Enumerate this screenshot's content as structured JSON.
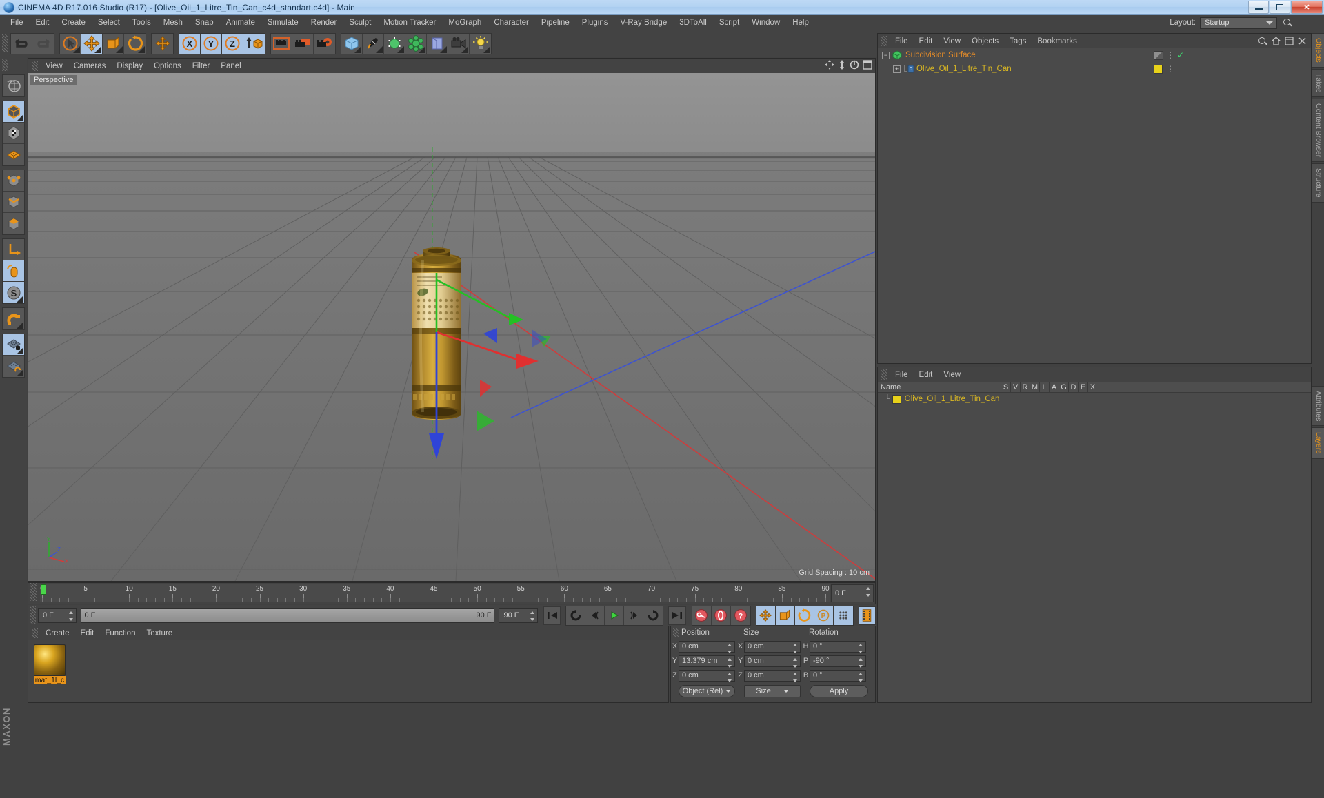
{
  "window": {
    "title": "CINEMA 4D R17.016 Studio (R17) - [Olive_Oil_1_Litre_Tin_Can_c4d_standart.c4d] - Main",
    "minimize": "–",
    "restore": "❐",
    "close": "X"
  },
  "menubar": {
    "items": [
      "File",
      "Edit",
      "Create",
      "Select",
      "Tools",
      "Mesh",
      "Snap",
      "Animate",
      "Simulate",
      "Render",
      "Sculpt",
      "Motion Tracker",
      "MoGraph",
      "Character",
      "Pipeline",
      "Plugins",
      "V-Ray Bridge",
      "3DToAll",
      "Script",
      "Window",
      "Help"
    ]
  },
  "layout": {
    "label": "Layout:",
    "value": "Startup",
    "search_icon": "search-icon"
  },
  "viewport": {
    "menu": [
      "View",
      "Cameras",
      "Display",
      "Options",
      "Filter",
      "Panel"
    ],
    "badge": "Perspective",
    "grid_spacing": "Grid Spacing : 10 cm",
    "axis_labels": {
      "x": "X",
      "y": "Y",
      "z": "Z"
    }
  },
  "timeline": {
    "ticks": [
      "0",
      "5",
      "10",
      "15",
      "20",
      "25",
      "30",
      "35",
      "40",
      "45",
      "50",
      "55",
      "60",
      "65",
      "70",
      "75",
      "80",
      "85",
      "90"
    ],
    "current_frame_field": "0 F",
    "range_start": "0 F",
    "range_end": "90 F",
    "max_frame_field": "90 F",
    "playhead_frame": 0
  },
  "animtools": {
    "frame_field": "0 F",
    "slider_left": "0 F",
    "slider_right": "90 F",
    "end_field": "90 F",
    "buttons": [
      "go-to-start-icon",
      "go-back-frame-icon",
      "play-back-icon",
      "play-icon",
      "play-forward-icon",
      "loop-icon",
      "go-to-end-icon",
      "record-key-icon",
      "autokey-icon",
      "key-help-icon",
      "position-key-icon",
      "scale-key-icon",
      "rotation-key-icon",
      "param-key-icon",
      "pla-key-icon",
      "timeline-strip-icon"
    ]
  },
  "material_manager": {
    "menu": [
      "Create",
      "Edit",
      "Function",
      "Texture"
    ],
    "materials": [
      {
        "name": "mat_1l_c",
        "thumb": "sphere-preview"
      }
    ]
  },
  "coordinates": {
    "headers": [
      "Position",
      "Size",
      "Rotation"
    ],
    "position": {
      "x": "0 cm",
      "y": "13.379 cm",
      "z": "0 cm"
    },
    "size": {
      "x": "0 cm",
      "y": "0 cm",
      "z": "0 cm"
    },
    "rotation": {
      "h": "0 °",
      "p": "-90 °",
      "b": "0 °"
    },
    "axis_labels": {
      "px": "X",
      "py": "Y",
      "pz": "Z",
      "sx": "X",
      "sy": "Y",
      "sz": "Z",
      "rh": "H",
      "rp": "P",
      "rb": "B"
    },
    "mode_select": "Object (Rel)",
    "size_select": "Size",
    "apply_button": "Apply"
  },
  "object_manager": {
    "menu": [
      "File",
      "Edit",
      "View",
      "Objects",
      "Tags",
      "Bookmarks"
    ],
    "items": [
      {
        "label": "Subdivision Surface",
        "level": 0,
        "color": "#e08a2a",
        "tag": "checkmark",
        "expander": "−"
      },
      {
        "label": "Olive_Oil_1_Litre_Tin_Can",
        "level": 1,
        "color": "#d9b723",
        "tag": "material-swatch",
        "expander": "+"
      }
    ]
  },
  "attribute_manager": {
    "menu": [
      "File",
      "Edit",
      "View"
    ],
    "columns": [
      "Name",
      "S",
      "V",
      "R",
      "M",
      "L",
      "A",
      "G",
      "D",
      "E",
      "X"
    ],
    "rows": [
      {
        "name": "Olive_Oil_1_Litre_Tin_Can",
        "swatch": "#e8d21a"
      }
    ]
  },
  "side_tabs": {
    "top": [
      "Objects",
      "Takes",
      "Content Browser",
      "Structure"
    ],
    "top_selected": "Objects",
    "bottom": [
      "Attributes",
      "Layers"
    ],
    "bottom_selected": "Layers"
  },
  "branding": {
    "maxon": "MAXON",
    "cinema4d": "CINEMA 4D"
  },
  "colors": {
    "accent_orange": "#e8941a",
    "panel_bg": "#434343",
    "field_bg": "#4f4f4f",
    "active_blue": "#a9c4e4",
    "axis_x": "#d93a3a",
    "axis_y": "#35c935",
    "axis_z": "#3b52d6"
  }
}
